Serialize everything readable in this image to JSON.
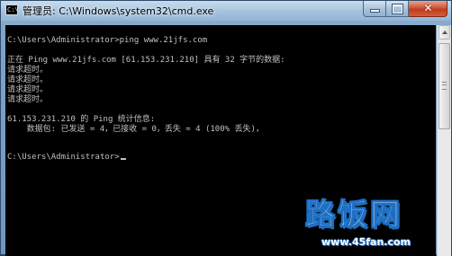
{
  "window": {
    "title": "管理员: C:\\Windows\\system32\\cmd.exe",
    "icon": "cmd-icon",
    "icon_text": "C:\\",
    "caption": {
      "minimize": "minimize-icon",
      "maximize": "maximize-icon",
      "close": "close-icon",
      "close_glyph": "✕"
    }
  },
  "console": {
    "lines": [
      "",
      "C:\\Users\\Administrator>ping www.21jfs.com",
      "",
      "正在 Ping www.21jfs.com [61.153.231.210] 具有 32 字节的数据:",
      "请求超时。",
      "请求超时。",
      "请求超时。",
      "请求超时。",
      "",
      "61.153.231.210 的 Ping 统计信息:",
      "    数据包: 已发送 = 4，已接收 = 0，丢失 = 4 (100% 丢失)，",
      "",
      "C:\\Users\\Administrator>"
    ],
    "colors": {
      "background": "#000000",
      "text": "#c0c0c0"
    }
  },
  "watermark": {
    "logo_text": "路饭网",
    "url": "www.45fan.com",
    "color": "#1e6fc2"
  }
}
